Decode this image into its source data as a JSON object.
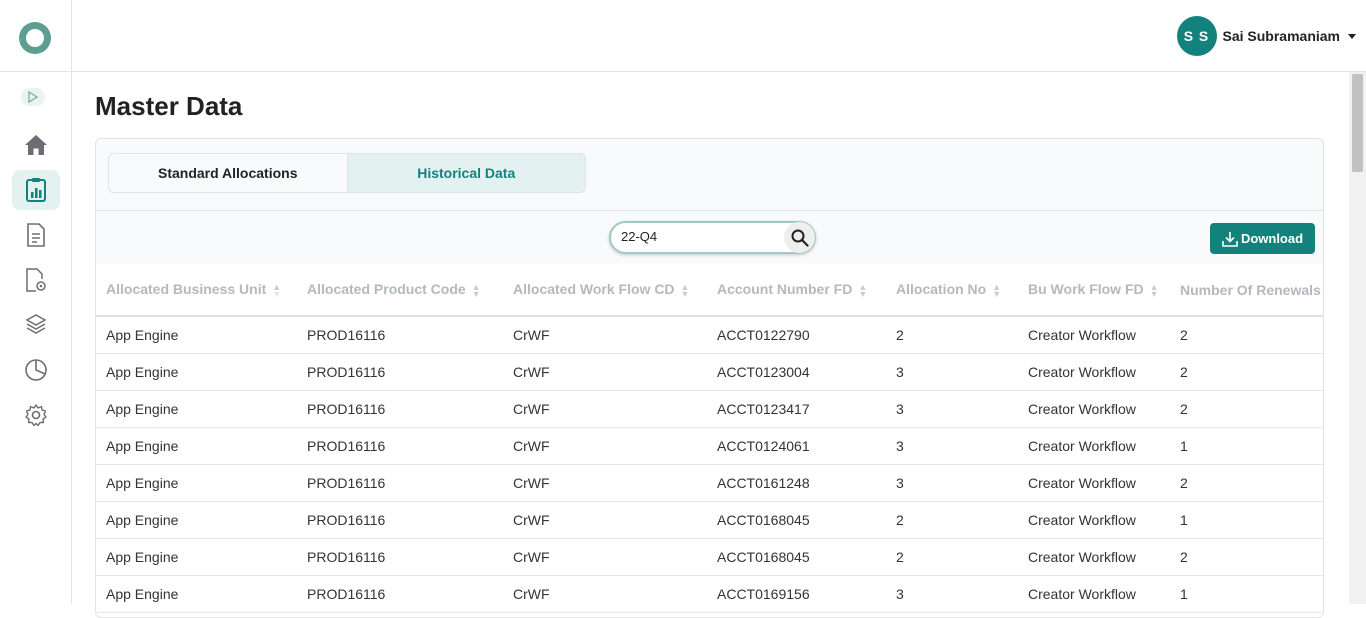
{
  "sidebar": {
    "logo": "logo-icon",
    "expand": "play-icon",
    "items": [
      {
        "icon": "home-icon",
        "name": "home"
      },
      {
        "icon": "clipboard-chart-icon",
        "name": "master-data",
        "active": true
      },
      {
        "icon": "document-icon",
        "name": "documents"
      },
      {
        "icon": "file-settings-icon",
        "name": "file-settings"
      },
      {
        "icon": "layers-icon",
        "name": "layers"
      },
      {
        "icon": "pie-chart-icon",
        "name": "reports"
      },
      {
        "icon": "gear-icon",
        "name": "settings"
      }
    ]
  },
  "header": {
    "user": {
      "initials": "S S",
      "name": "Sai Subramaniam"
    }
  },
  "page": {
    "title": "Master Data"
  },
  "tabs": [
    {
      "label": "Standard Allocations",
      "active": false
    },
    {
      "label": "Historical Data",
      "active": true
    }
  ],
  "search": {
    "value": "22-Q4",
    "placeholder": ""
  },
  "toolbar": {
    "download_label": "Download"
  },
  "table": {
    "columns": [
      "Allocated Business Unit",
      "Allocated Product Code",
      "Allocated Work Flow CD",
      "Account Number FD",
      "Allocation No",
      "Bu Work Flow FD",
      "Number Of Renewals"
    ],
    "rows": [
      [
        "App Engine",
        "PROD16116",
        "CrWF",
        "ACCT0122790",
        "2",
        "Creator Workflow",
        "2"
      ],
      [
        "App Engine",
        "PROD16116",
        "CrWF",
        "ACCT0123004",
        "3",
        "Creator Workflow",
        "2"
      ],
      [
        "App Engine",
        "PROD16116",
        "CrWF",
        "ACCT0123417",
        "3",
        "Creator Workflow",
        "2"
      ],
      [
        "App Engine",
        "PROD16116",
        "CrWF",
        "ACCT0124061",
        "3",
        "Creator Workflow",
        "1"
      ],
      [
        "App Engine",
        "PROD16116",
        "CrWF",
        "ACCT0161248",
        "3",
        "Creator Workflow",
        "2"
      ],
      [
        "App Engine",
        "PROD16116",
        "CrWF",
        "ACCT0168045",
        "2",
        "Creator Workflow",
        "1"
      ],
      [
        "App Engine",
        "PROD16116",
        "CrWF",
        "ACCT0168045",
        "2",
        "Creator Workflow",
        "2"
      ],
      [
        "App Engine",
        "PROD16116",
        "CrWF",
        "ACCT0169156",
        "3",
        "Creator Workflow",
        "1"
      ]
    ]
  },
  "colors": {
    "accent": "#14827c",
    "active_bg": "#e3f1f0",
    "header_text": "#b3b9be"
  }
}
